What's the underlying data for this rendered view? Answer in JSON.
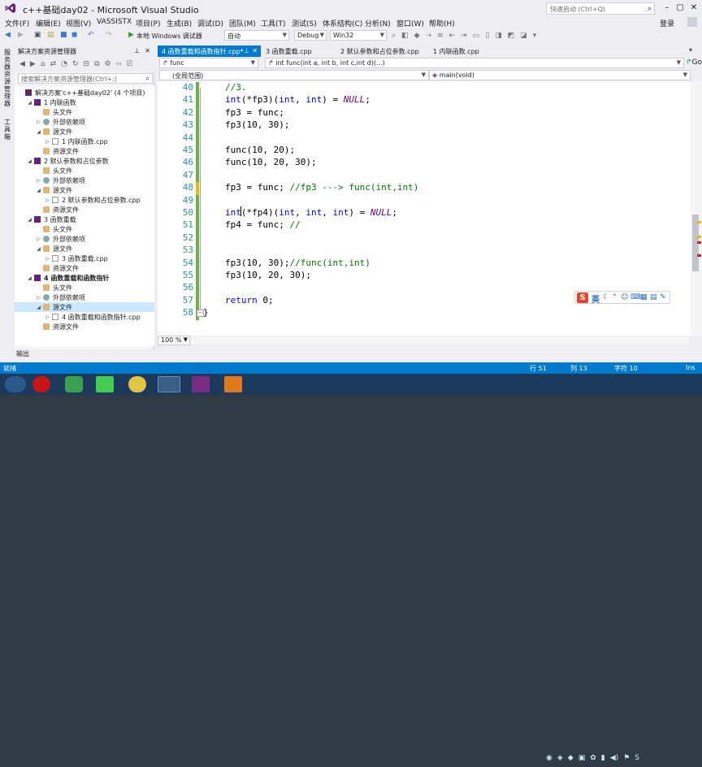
{
  "window": {
    "title": "c++基础day02 - Microsoft Visual Studio",
    "quick_launch_placeholder": "快速启动 (Ctrl+Q)",
    "login": "登录"
  },
  "menu": [
    "文件(F)",
    "编辑(E)",
    "视图(V)",
    "VASSISTX",
    "项目(P)",
    "生成(B)",
    "调试(D)",
    "团队(M)",
    "工具(T)",
    "测试(S)",
    "体系结构(C)",
    "分析(N)",
    "窗口(W)",
    "帮助(H)"
  ],
  "toolbar": {
    "debugger_label": "本地 Windows 调试器",
    "mode": "自动",
    "config": "Debug",
    "platform": "Win32"
  },
  "side_tabs": [
    "服务器资源管理器",
    "工具箱"
  ],
  "solution_explorer": {
    "title": "解决方案资源管理器",
    "search_placeholder": "搜索解决方案资源管理器(Ctrl+;)",
    "tree": [
      {
        "label": "解决方案'c++基础day02' (4 个项目)",
        "indent": 0,
        "kind": "sol",
        "expanded": ""
      },
      {
        "label": "1 内联函数",
        "indent": 1,
        "kind": "proj",
        "expanded": "▲"
      },
      {
        "label": "头文件",
        "indent": 2,
        "kind": "fold",
        "expanded": ""
      },
      {
        "label": "外部依赖项",
        "indent": 2,
        "kind": "dep",
        "expanded": "▶"
      },
      {
        "label": "源文件",
        "indent": 2,
        "kind": "fold",
        "expanded": "▲"
      },
      {
        "label": "1 内联函数.cpp",
        "indent": 3,
        "kind": "cpp",
        "expanded": "▶"
      },
      {
        "label": "资源文件",
        "indent": 2,
        "kind": "fold",
        "expanded": ""
      },
      {
        "label": "2 默认参数和占位参数",
        "indent": 1,
        "kind": "proj",
        "expanded": "▲"
      },
      {
        "label": "头文件",
        "indent": 2,
        "kind": "fold",
        "expanded": ""
      },
      {
        "label": "外部依赖项",
        "indent": 2,
        "kind": "dep",
        "expanded": "▶"
      },
      {
        "label": "源文件",
        "indent": 2,
        "kind": "fold",
        "expanded": "▲"
      },
      {
        "label": "2 默认参数和占位参数.cpp",
        "indent": 3,
        "kind": "cpp",
        "expanded": "▶"
      },
      {
        "label": "资源文件",
        "indent": 2,
        "kind": "fold",
        "expanded": ""
      },
      {
        "label": "3 函数重载",
        "indent": 1,
        "kind": "proj",
        "expanded": "▲"
      },
      {
        "label": "头文件",
        "indent": 2,
        "kind": "fold",
        "expanded": ""
      },
      {
        "label": "外部依赖项",
        "indent": 2,
        "kind": "dep",
        "expanded": "▶"
      },
      {
        "label": "源文件",
        "indent": 2,
        "kind": "fold",
        "expanded": "▲"
      },
      {
        "label": "3 函数重载.cpp",
        "indent": 3,
        "kind": "cpp",
        "expanded": "▶"
      },
      {
        "label": "资源文件",
        "indent": 2,
        "kind": "fold",
        "expanded": ""
      },
      {
        "label": "4 函数重载和函数指针",
        "indent": 1,
        "kind": "proj",
        "expanded": "▲",
        "bold": true
      },
      {
        "label": "头文件",
        "indent": 2,
        "kind": "fold",
        "expanded": ""
      },
      {
        "label": "外部依赖项",
        "indent": 2,
        "kind": "dep",
        "expanded": "▶"
      },
      {
        "label": "源文件",
        "indent": 2,
        "kind": "fold",
        "expanded": "▲",
        "selected": true
      },
      {
        "label": "4 函数重载和函数指针.cpp",
        "indent": 3,
        "kind": "cpp",
        "expanded": "▶"
      },
      {
        "label": "资源文件",
        "indent": 2,
        "kind": "fold",
        "expanded": ""
      }
    ]
  },
  "doc_tabs": [
    {
      "label": "4 函数重载和函数指针.cpp*",
      "active": true
    },
    {
      "label": "3 函数重载.cpp",
      "active": false
    },
    {
      "label": "2 默认参数和占位参数.cpp",
      "active": false
    },
    {
      "label": "1 内联函数.cpp",
      "active": false
    }
  ],
  "nav": {
    "scope_top": "func",
    "member_top": "int func(int a, int b, int c,int d)(...)",
    "scope": "(全局范围)",
    "member": "main(void)",
    "go": "Go"
  },
  "code_lines": [
    {
      "n": "40",
      "text": "//3."
    },
    {
      "n": "41",
      "text": "int(*fp3)(int, int) = NULL;"
    },
    {
      "n": "42",
      "text": "fp3 = func;"
    },
    {
      "n": "43",
      "text": "fp3(10, 30);"
    },
    {
      "n": "44",
      "text": ""
    },
    {
      "n": "45",
      "text": "func(10, 20);"
    },
    {
      "n": "46",
      "text": "func(10, 20, 30);"
    },
    {
      "n": "47",
      "text": ""
    },
    {
      "n": "48",
      "text": "fp3 = func; //fp3 ---> func(int,int)"
    },
    {
      "n": "49",
      "text": ""
    },
    {
      "n": "50",
      "text": "int(*fp4)(int, int, int) = NULL;"
    },
    {
      "n": "51",
      "text": "fp4 = func; //"
    },
    {
      "n": "52",
      "text": ""
    },
    {
      "n": "53",
      "text": ""
    },
    {
      "n": "54",
      "text": "fp3(10, 30);//func(int,int)"
    },
    {
      "n": "55",
      "text": "fp3(10, 20, 30);"
    },
    {
      "n": "56",
      "text": ""
    },
    {
      "n": "57",
      "text": "return 0;"
    },
    {
      "n": "58",
      "text": "}"
    }
  ],
  "editor": {
    "zoom": "100 %"
  },
  "output_tab": "输出",
  "status": {
    "ready": "就绪",
    "line": "行 51",
    "col": "列 13",
    "char": "字符 10",
    "ins": "Ins"
  },
  "ime": {
    "mode": "英"
  },
  "colors": {
    "accent": "#007acc",
    "comment": "#008000",
    "keyword": "#0000ff",
    "macro": "#6f008a",
    "line_number": "#2b91af"
  }
}
